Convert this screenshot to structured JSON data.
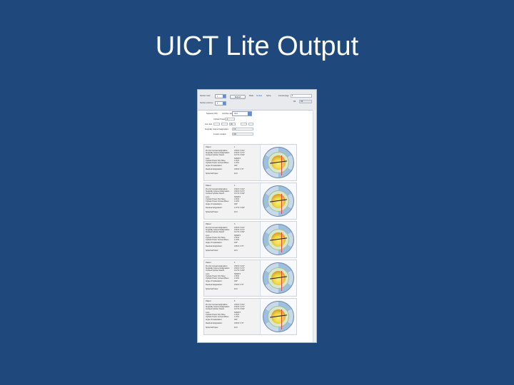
{
  "slide": {
    "title": "UICT Lite Output"
  },
  "toolbar": {
    "number_rows_label": "Number rows:",
    "number_rows_value": "1",
    "number_columns_label": "Number columns:",
    "number_columns_value": "5",
    "button_label": "Refresh",
    "mode_label": "Mode:",
    "mode_opt_a": "Surface",
    "mode_opt_b": "Spline",
    "interval_label": "Interval (deg):",
    "interval_value": "5",
    "fill_label": "Fill:",
    "fill_value": "Off"
  },
  "form": {
    "radio_a": "Separate (OD)",
    "radio_b": "Combine Jan",
    "select_value": "ALL",
    "field_labels": [
      "Cylinder Power",
      "Axis, Axis",
      "Surgically Induced Astigmatism",
      "Incision Location"
    ],
    "field_values": [
      "-4",
      "90",
      "0.5",
      "180"
    ]
  },
  "results": [
    {
      "patient_label": "Patient:",
      "patient_value": "1",
      "rows": [
        [
          "Pre-Op Corneal Astigmatism:",
          "0.50 D X 161°"
        ],
        [
          "Surgically Induced Astigmatism:",
          "0.50 D X 271°"
        ],
        [
          "Crossed Cylinder Result:",
          "0.47 D X 166°"
        ],
        [
          "Lens:",
          "SN6AT3"
        ],
        [
          "Cylinder Power IOL Plane:",
          "1.50 D"
        ],
        [
          "Cylinder Power Corneal Plane:",
          "1.03 D"
        ],
        [
          "Angle of Implantation:",
          "166°"
        ]
      ],
      "residual_label": "Residual Astigmatism:",
      "residual_value": "0.56 D X 76°",
      "spherical_label": "Spherical Power:",
      "spherical_value": "22.0"
    },
    {
      "patient_label": "Patient:",
      "patient_value": "2",
      "rows": [
        [
          "Pre-Op Corneal Astigmatism:",
          "0.50 D X 161°"
        ],
        [
          "Surgically Induced Astigmatism:",
          "0.50 D X 271°"
        ],
        [
          "Crossed Cylinder Result:",
          "0.47 D X 166°"
        ],
        [
          "Lens:",
          "SN6AT3"
        ],
        [
          "Cylinder Power IOL Plane:",
          "1.50 D"
        ],
        [
          "Cylinder Power Corneal Plane:",
          "1.03 D"
        ],
        [
          "Angle of Implantation:",
          "166°"
        ]
      ],
      "residual_label": "Residual Astigmatism:",
      "residual_value": "1.07 D X 166°",
      "spherical_label": "Spherical Power:",
      "spherical_value": "22.0"
    },
    {
      "patient_label": "Patient:",
      "patient_value": "3",
      "rows": [
        [
          "Pre-Op Corneal Astigmatism:",
          "0.50 D X 161°"
        ],
        [
          "Surgically Induced Astigmatism:",
          "0.50 D X 271°"
        ],
        [
          "Crossed Cylinder Result:",
          "0.47 D X 166°"
        ],
        [
          "Lens:",
          "SN6AT3"
        ],
        [
          "Cylinder Power IOL Plane:",
          "1.50 D"
        ],
        [
          "Cylinder Power Corneal Plane:",
          "1.03 D"
        ],
        [
          "Angle of Implantation:",
          "166°"
        ]
      ],
      "residual_label": "Residual Astigmatism:",
      "residual_value": "0.56 D X 76°",
      "spherical_label": "Spherical Power:",
      "spherical_value": "22.0"
    },
    {
      "patient_label": "Patient:",
      "patient_value": "4",
      "rows": [
        [
          "Pre-Op Corneal Astigmatism:",
          "0.50 D X 161°"
        ],
        [
          "Surgically Induced Astigmatism:",
          "0.50 D X 271°"
        ],
        [
          "Crossed Cylinder Result:",
          "0.47 D X 166°"
        ],
        [
          "Lens:",
          "SN6AT3"
        ],
        [
          "Cylinder Power IOL Plane:",
          "1.50 D"
        ],
        [
          "Cylinder Power Corneal Plane:",
          "1.03 D"
        ],
        [
          "Angle of Implantation:",
          "166°"
        ]
      ],
      "residual_label": "Residual Astigmatism:",
      "residual_value": "0.56 D X 76°",
      "spherical_label": "Spherical Power:",
      "spherical_value": "22.0"
    },
    {
      "patient_label": "Patient:",
      "patient_value": "5",
      "rows": [
        [
          "Pre-Op Corneal Astigmatism:",
          "0.50 D X 161°"
        ],
        [
          "Surgically Induced Astigmatism:",
          "0.50 D X 271°"
        ],
        [
          "Crossed Cylinder Result:",
          "0.47 D X 166°"
        ],
        [
          "Lens:",
          "SN6AT3"
        ],
        [
          "Cylinder Power IOL Plane:",
          "1.50 D"
        ],
        [
          "Cylinder Power Corneal Plane:",
          "1.03 D"
        ],
        [
          "Angle of Implantation:",
          "166°"
        ]
      ],
      "residual_label": "Residual Astigmatism:",
      "residual_value": "0.56 D X 76°",
      "spherical_label": "Spherical Power:",
      "spherical_value": "22.0"
    }
  ],
  "colors": {
    "background": "#1f497d",
    "title": "#ffffff",
    "accent": "#5a8ede"
  }
}
